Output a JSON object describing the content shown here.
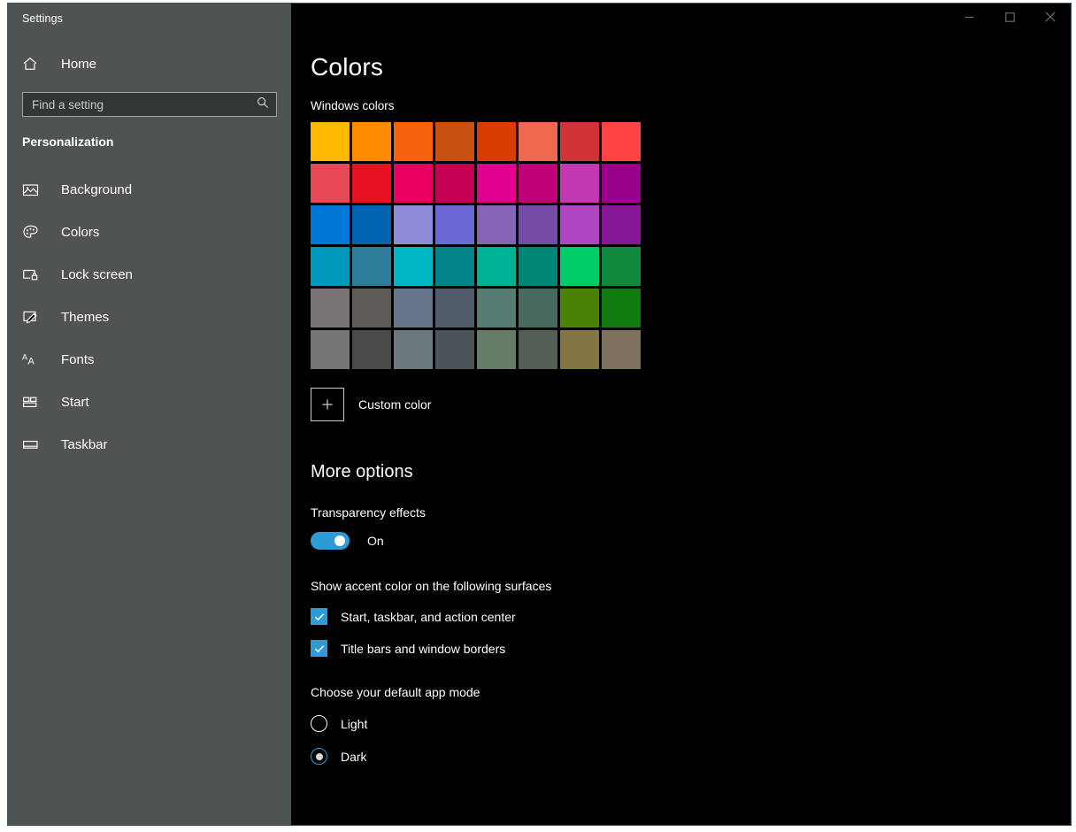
{
  "window": {
    "app_title": "Settings",
    "controls": [
      {
        "name": "minimize",
        "glyph": "minimize-icon"
      },
      {
        "name": "maximize",
        "glyph": "maximize-icon"
      },
      {
        "name": "close",
        "glyph": "close-icon"
      }
    ]
  },
  "sidebar": {
    "home_label": "Home",
    "home_icon": "home-icon",
    "search": {
      "placeholder": "Find a setting",
      "value": "",
      "icon": "search-icon"
    },
    "category": "Personalization",
    "items": [
      {
        "label": "Background",
        "icon": "picture-icon",
        "selected": false
      },
      {
        "label": "Colors",
        "icon": "palette-icon",
        "selected": true
      },
      {
        "label": "Lock screen",
        "icon": "lock-screen-icon",
        "selected": false
      },
      {
        "label": "Themes",
        "icon": "themes-brush-icon",
        "selected": false
      },
      {
        "label": "Fonts",
        "icon": "fonts-icon",
        "selected": false
      },
      {
        "label": "Start",
        "icon": "start-tiles-icon",
        "selected": false
      },
      {
        "label": "Taskbar",
        "icon": "taskbar-icon",
        "selected": false
      }
    ]
  },
  "main": {
    "page_title": "Colors",
    "windows_colors_label": "Windows colors",
    "swatches": [
      "#ffb900",
      "#ff8c00",
      "#f7630c",
      "#ca5010",
      "#da3b01",
      "#ef6950",
      "#d13438",
      "#ff4343",
      "#e74856",
      "#e81123",
      "#ea005e",
      "#c30052",
      "#e3008c",
      "#bf0077",
      "#c239b3",
      "#9a0089",
      "#0078d7",
      "#0063b1",
      "#8e8cd8",
      "#6b69d6",
      "#8764b8",
      "#744da9",
      "#b146c2",
      "#881798",
      "#0099bc",
      "#2d7d9a",
      "#00b7c3",
      "#038387",
      "#00b294",
      "#018574",
      "#00cc6a",
      "#10893e",
      "#7a7574",
      "#5d5a58",
      "#68768a",
      "#515c6b",
      "#567c73",
      "#486860",
      "#498205",
      "#107c10",
      "#767676",
      "#4c4a48",
      "#69797e",
      "#4a5459",
      "#647c64",
      "#525e54",
      "#847545",
      "#7e735f"
    ],
    "custom_color": {
      "label": "Custom color",
      "icon": "plus-icon"
    },
    "more_options_title": "More options",
    "transparency": {
      "label": "Transparency effects",
      "state_text": "On",
      "on": true
    },
    "accent_surfaces": {
      "label": "Show accent color on the following surfaces",
      "options": [
        {
          "label": "Start, taskbar, and action center",
          "checked": true
        },
        {
          "label": "Title bars and window borders",
          "checked": true
        }
      ]
    },
    "app_mode": {
      "label": "Choose your default app mode",
      "options": [
        {
          "label": "Light",
          "selected": false
        },
        {
          "label": "Dark",
          "selected": true
        }
      ]
    }
  },
  "colors": {
    "accent": "#2e9bd6",
    "sidebar_bg": "#4f5352",
    "main_bg": "#000000"
  }
}
